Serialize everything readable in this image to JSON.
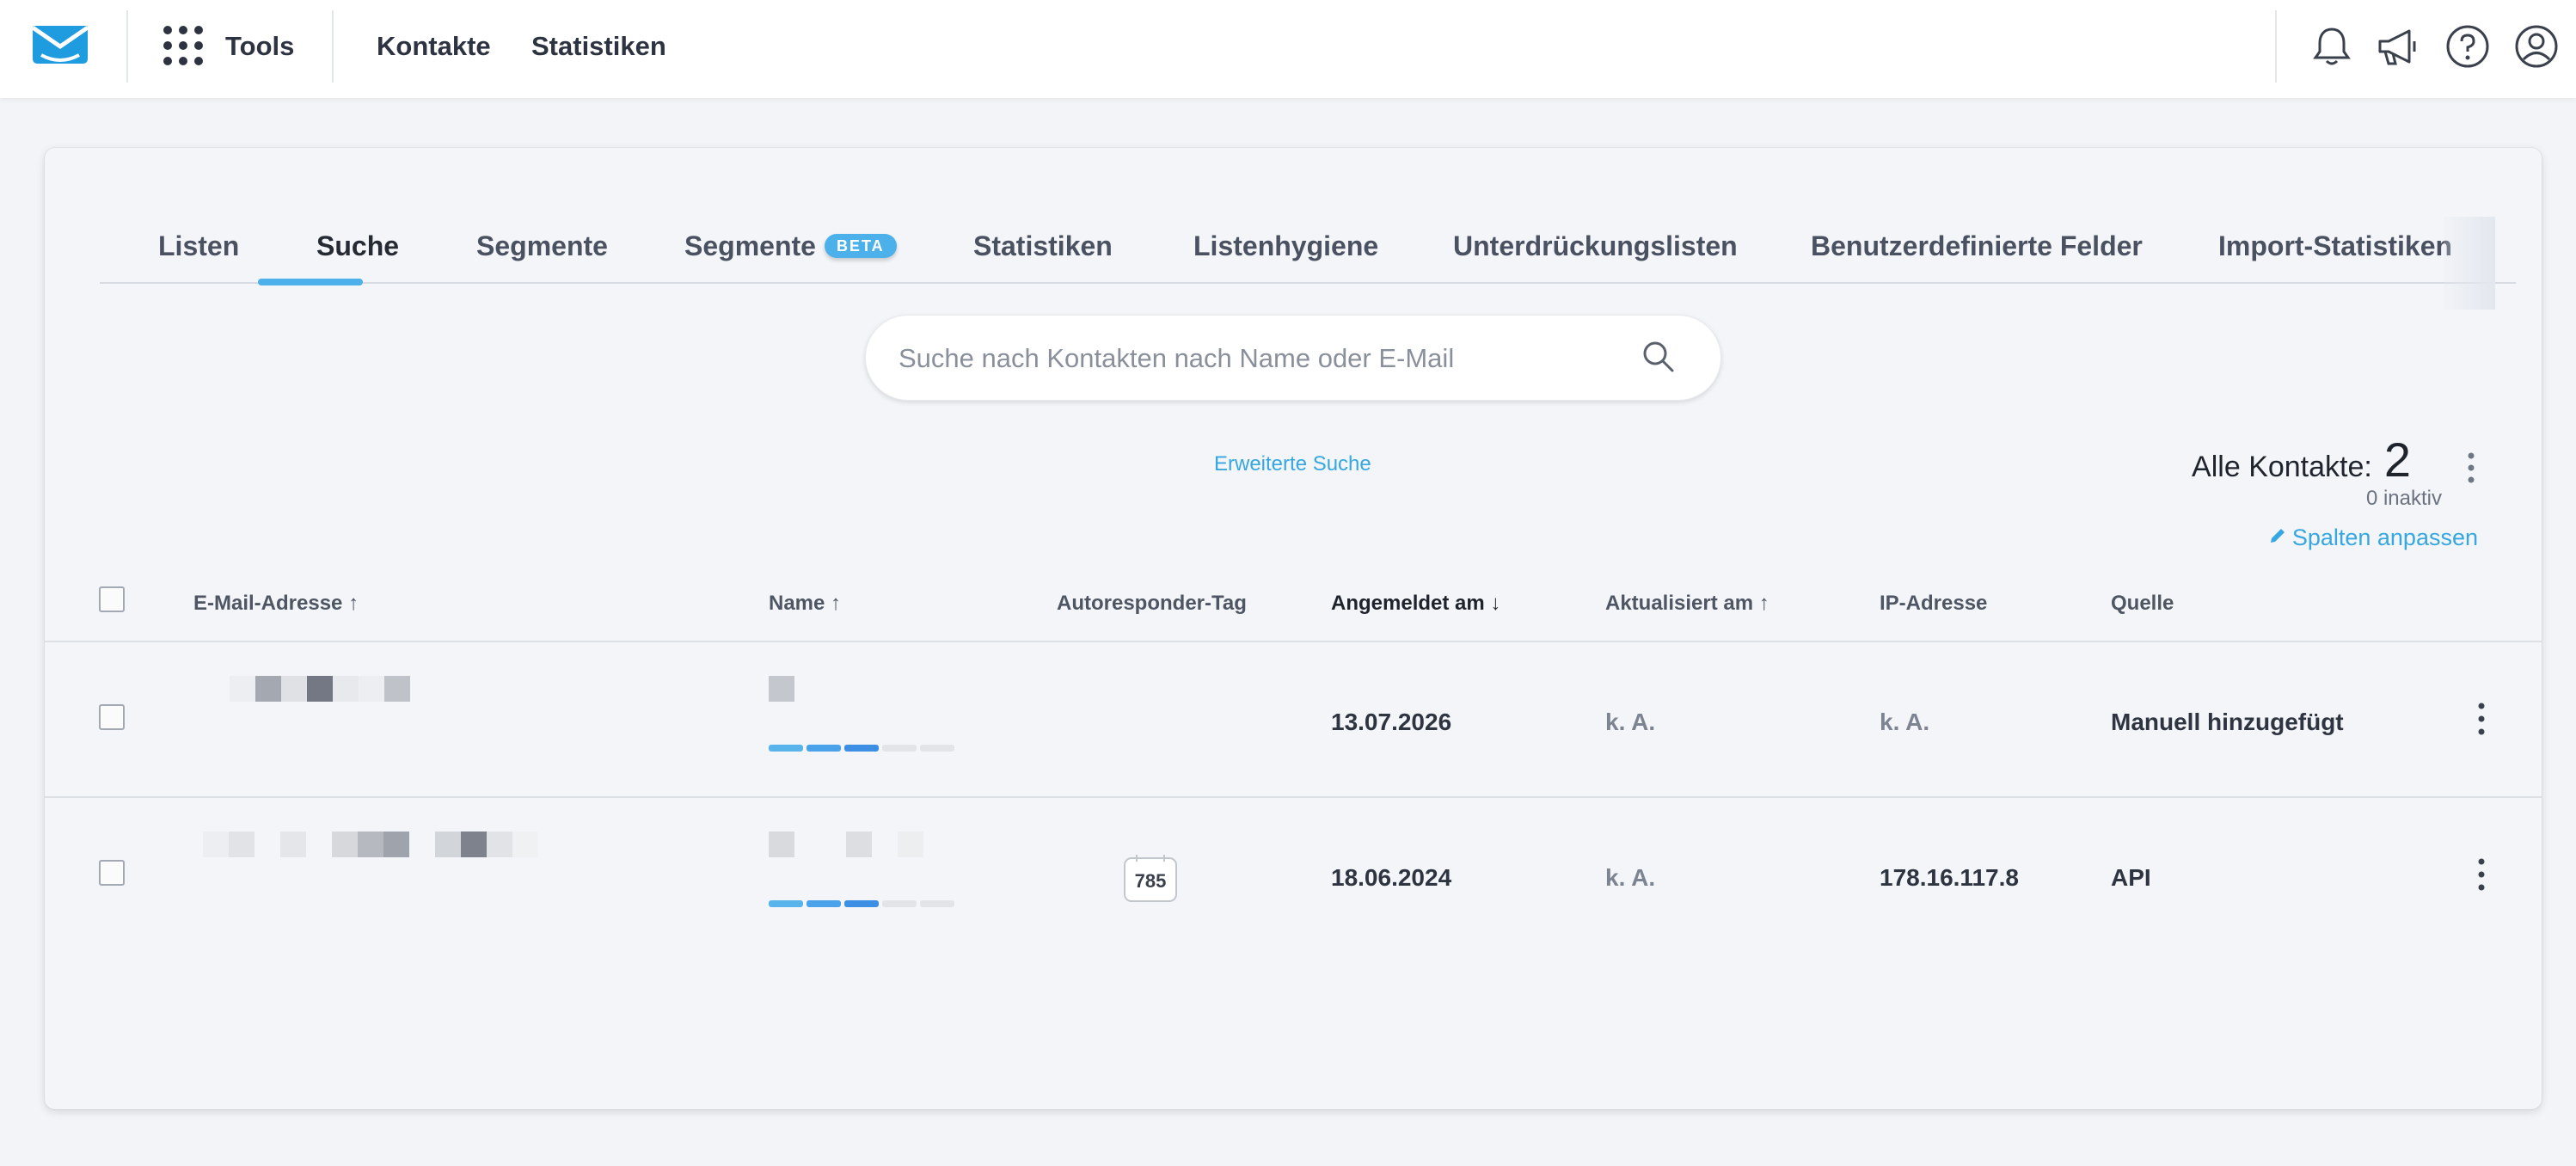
{
  "topbar": {
    "tools_label": "Tools",
    "nav": [
      "Kontakte",
      "Statistiken"
    ]
  },
  "tabs": [
    {
      "label": "Listen"
    },
    {
      "label": "Suche"
    },
    {
      "label": "Segmente"
    },
    {
      "label": "Segmente",
      "badge": "BETA"
    },
    {
      "label": "Statistiken"
    },
    {
      "label": "Listenhygiene"
    },
    {
      "label": "Unterdrückungslisten"
    },
    {
      "label": "Benutzerdefinierte Felder"
    },
    {
      "label": "Import-Statistiken"
    }
  ],
  "search": {
    "placeholder": "Suche nach Kontakten nach Name oder E-Mail",
    "advanced_link": "Erweiterte Suche"
  },
  "summary": {
    "all_contacts_label": "Alle Kontakte:",
    "all_contacts_count": "2",
    "inactive": "0 inaktiv",
    "customize_columns": "Spalten anpassen"
  },
  "table": {
    "columns": {
      "email": "E-Mail-Adresse",
      "name": "Name",
      "autoresponder": "Autoresponder-Tag",
      "subscribed": "Angemeldet am",
      "updated": "Aktualisiert am",
      "ip": "IP-Adresse",
      "source": "Quelle"
    },
    "sort_icons": {
      "asc": "↑",
      "desc": "↓"
    },
    "rows": [
      {
        "autoresponder_day": "",
        "subscribed": "13.07.2026",
        "updated": "k. A.",
        "ip": "k. A.",
        "source": "Manuell hinzugefügt",
        "engagement_score": 3
      },
      {
        "autoresponder_day": "785",
        "subscribed": "18.06.2024",
        "updated": "k. A.",
        "ip": "178.16.117.8",
        "source": "API",
        "engagement_score": 3
      }
    ]
  },
  "colors": {
    "accent": "#4cb1ea",
    "link": "#36a7e0",
    "score_filled_light": "#5ab4ec",
    "score_filled_dark": "#3c8fe2",
    "score_empty": "#e2e4e8"
  },
  "icons": [
    "envelope-logo-icon",
    "apps-grid-icon",
    "bell-icon",
    "megaphone-icon",
    "help-icon",
    "account-icon",
    "search-icon",
    "kebab-icon",
    "pencil-icon",
    "calendar-icon"
  ]
}
